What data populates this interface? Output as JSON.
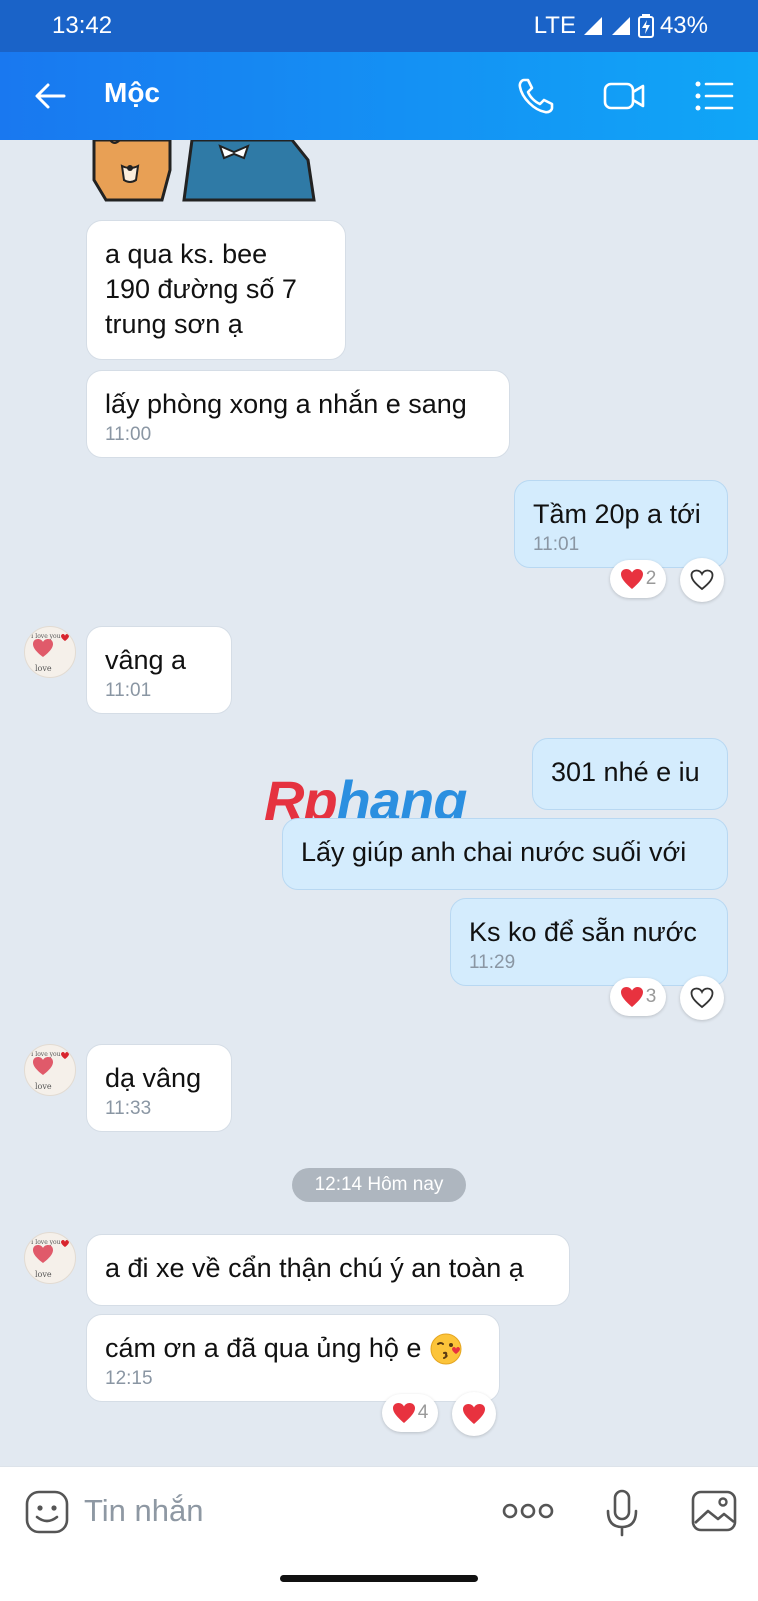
{
  "status_bar": {
    "time": "13:42",
    "network": "LTE",
    "battery": "43%"
  },
  "header": {
    "contact_name": "Mộc",
    "icons": [
      "back-arrow-icon",
      "phone-icon",
      "video-call-icon",
      "list-menu-icon"
    ]
  },
  "messages": [
    {
      "side": "in",
      "text": "a qua ks. bee\n190 đường số 7\ntrung sơn ạ",
      "time": ""
    },
    {
      "side": "in",
      "text": "lấy phòng xong a nhắn e sang",
      "time": "11:00"
    },
    {
      "side": "out",
      "text": "Tầm 20p a tới",
      "time": "11:01",
      "reaction_count": "2"
    },
    {
      "side": "in",
      "text": "vâng a",
      "time": "11:01"
    },
    {
      "side": "out",
      "text": "301 nhé e iu",
      "time": ""
    },
    {
      "side": "out",
      "text": "Lấy giúp anh chai nước suối với",
      "time": ""
    },
    {
      "side": "out",
      "text": "Ks ko để sẵn nước",
      "time": "11:29",
      "reaction_count": "3"
    },
    {
      "side": "in",
      "text": "dạ vâng",
      "time": "11:33"
    },
    {
      "side": "in",
      "text": "a đi xe về cẩn thận chú ý an toàn ạ",
      "time": ""
    },
    {
      "side": "in",
      "text": "cám ơn a đã qua ủng hộ e",
      "time": "12:15",
      "reaction_count": "4"
    }
  ],
  "date_divider": "12:14 Hôm nay",
  "watermark": {
    "part1": "Rp",
    "part2": "hang"
  },
  "avatar_text": {
    "line1": "I love you",
    "line2": "love"
  },
  "input": {
    "placeholder": "Tin nhắn"
  },
  "colors": {
    "status_bar": "#1a63c8",
    "header_start": "#1978f0",
    "header_end": "#10a6f7",
    "background": "#e2e9f1",
    "outgoing_bubble": "#d4ecfd",
    "incoming_bubble": "#ffffff",
    "reaction_heart": "#e8323f"
  }
}
